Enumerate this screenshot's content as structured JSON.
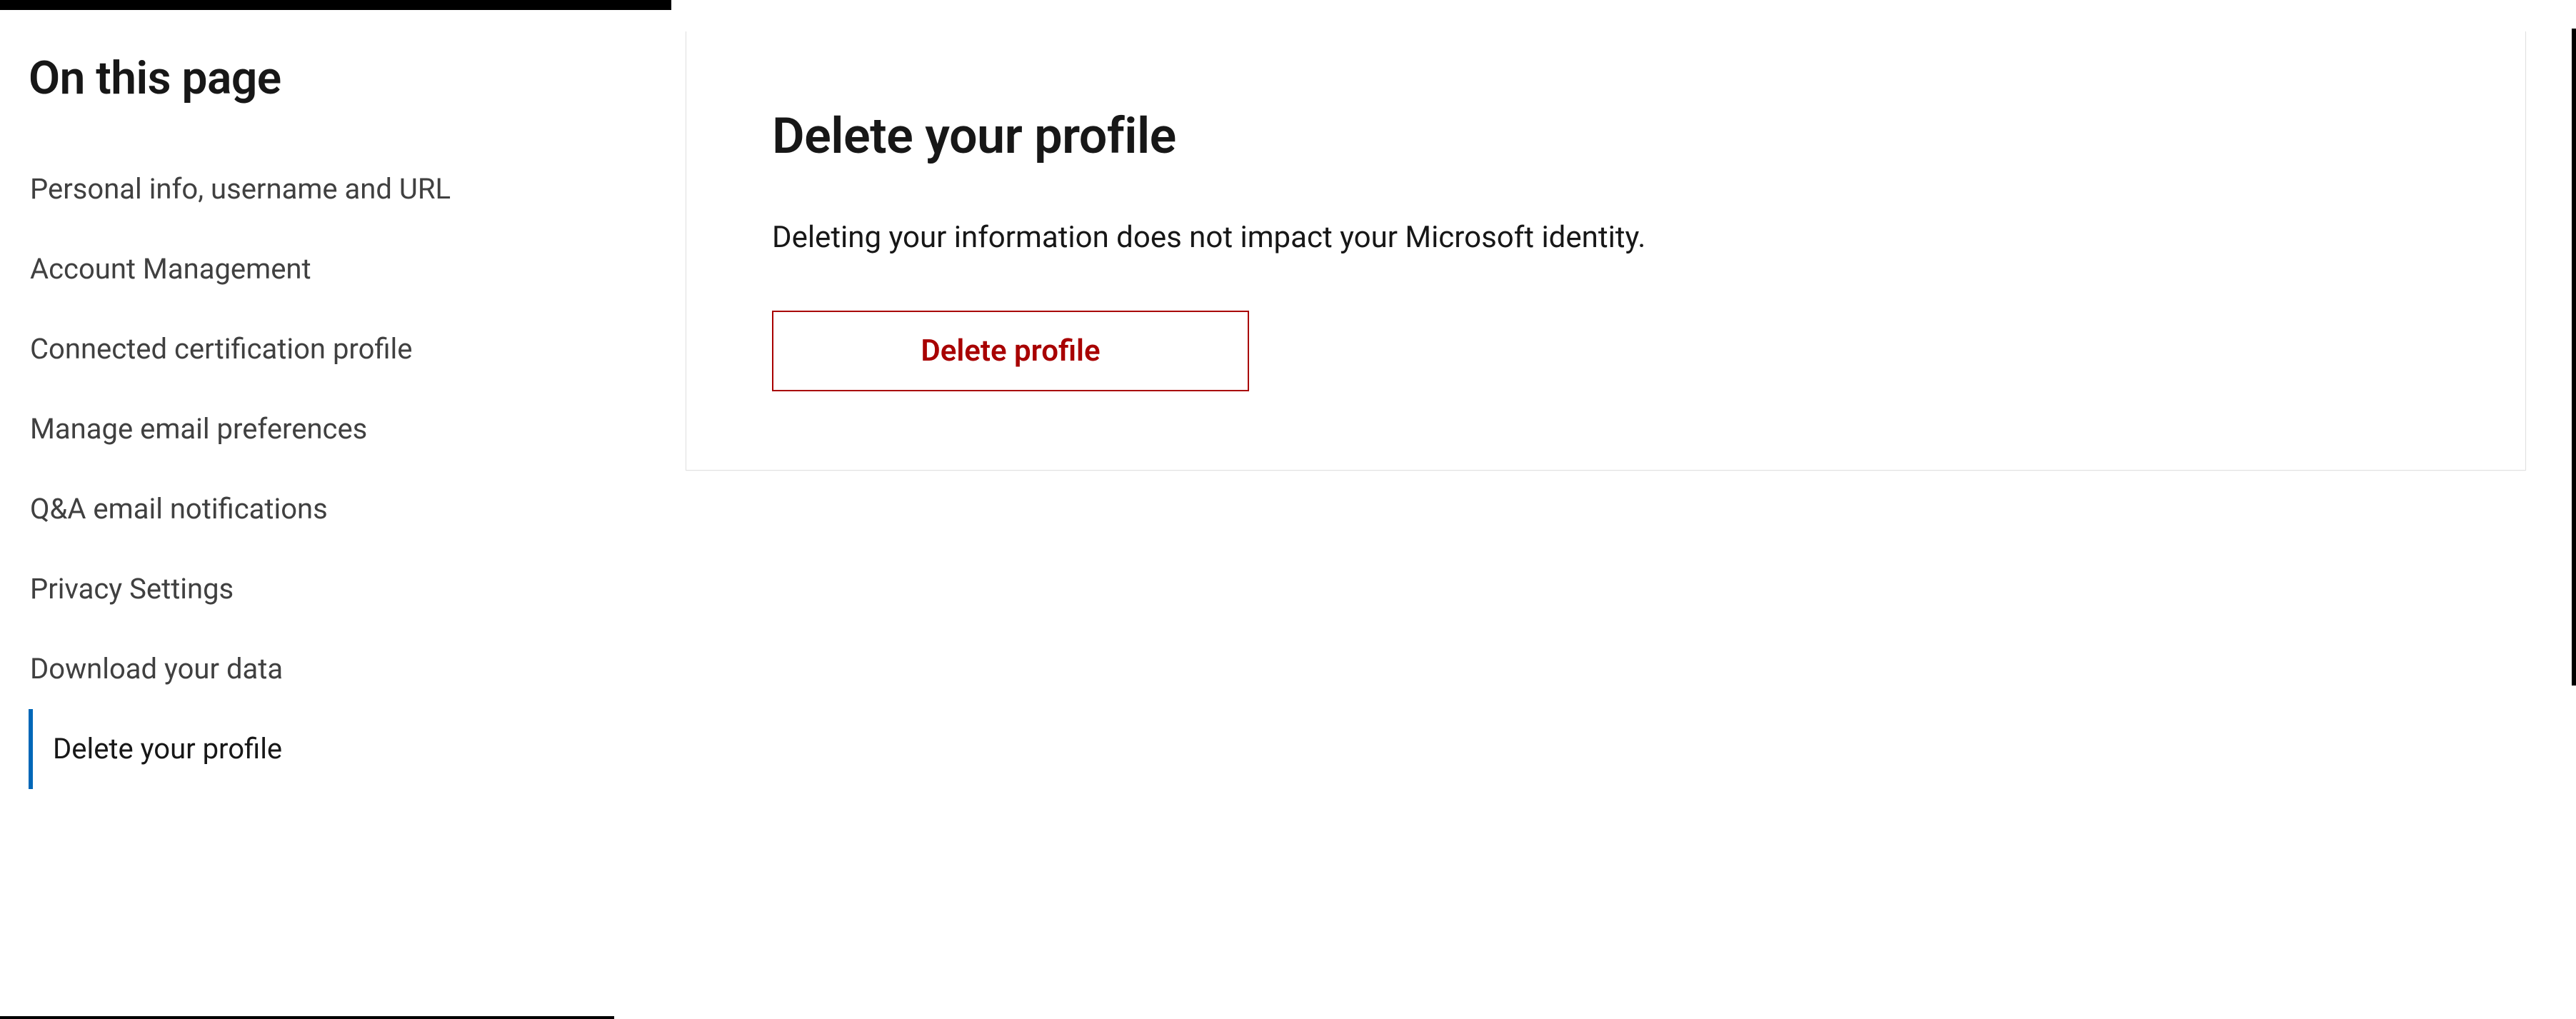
{
  "sidebar": {
    "title": "On this page",
    "items": [
      {
        "label": "Personal info, username and URL",
        "active": false
      },
      {
        "label": "Account Management",
        "active": false
      },
      {
        "label": "Connected certification profile",
        "active": false
      },
      {
        "label": "Manage email preferences",
        "active": false
      },
      {
        "label": "Q&A email notifications",
        "active": false
      },
      {
        "label": "Privacy Settings",
        "active": false
      },
      {
        "label": "Download your data",
        "active": false
      },
      {
        "label": "Delete your profile",
        "active": true
      }
    ]
  },
  "main": {
    "heading": "Delete your profile",
    "description": "Deleting your information does not impact your Microsoft identity.",
    "delete_button_label": "Delete profile"
  }
}
